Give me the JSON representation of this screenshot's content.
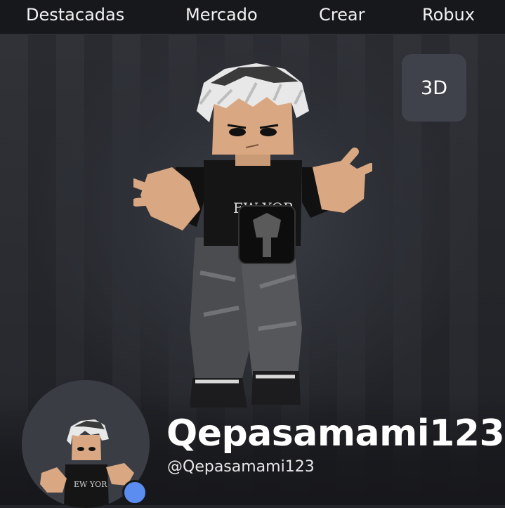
{
  "nav": {
    "items": [
      {
        "label": "Destacadas"
      },
      {
        "label": "Mercado"
      },
      {
        "label": "Crear"
      },
      {
        "label": "Robux"
      }
    ]
  },
  "viewer": {
    "toggle_label": "3D"
  },
  "profile": {
    "display_name": "Qepasamami123",
    "username": "@Qepasamami123",
    "presence_color": "#5b8cf0"
  },
  "icons": [
    "avatar-3d-figure",
    "avatar-headshot",
    "online-status-dot"
  ]
}
